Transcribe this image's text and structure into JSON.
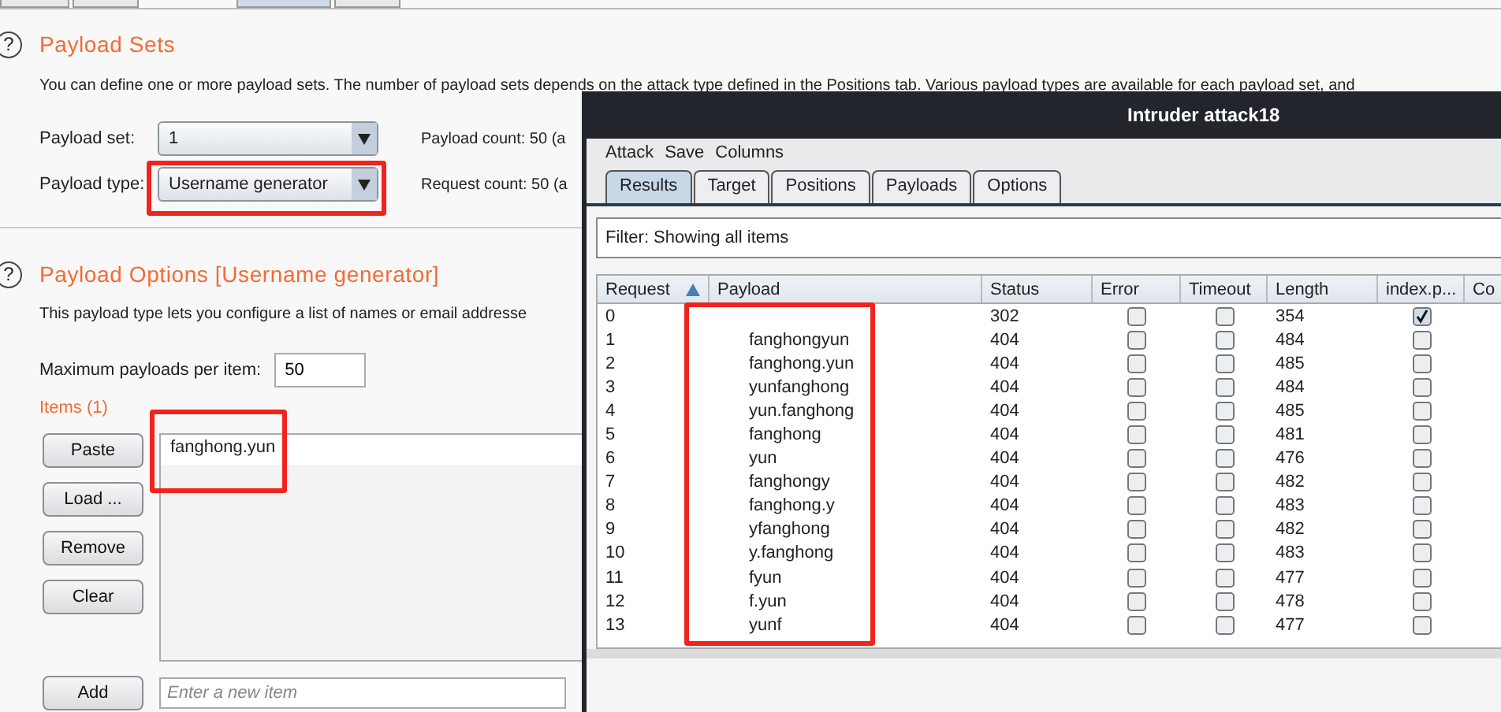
{
  "top_tabs": [
    {
      "selected": false
    },
    {
      "selected": false
    },
    {
      "selected": true
    },
    {
      "selected": false
    }
  ],
  "payload_sets": {
    "help_icon": "?",
    "title": "Payload Sets",
    "description": "You can define one or more payload sets. The number of payload sets depends on the attack type defined in the Positions tab. Various payload types are available for each payload set, and",
    "set_label": "Payload set:",
    "set_value": "1",
    "type_label": "Payload type:",
    "type_value": "Username generator",
    "payload_count": "Payload count:  50 (a",
    "request_count": "Request count:  50 (a"
  },
  "payload_options": {
    "help_icon": "?",
    "title": "Payload Options [Username generator]",
    "description": "This payload type lets you configure a list of names or email addresse",
    "max_label": "Maximum payloads per item:",
    "max_value": "50",
    "items_label": "Items (1)",
    "buttons": [
      "Paste",
      "Load ...",
      "Remove",
      "Clear"
    ],
    "items": [
      {
        "text": "fanghong.yun",
        "selected": true
      }
    ],
    "add_button": "Add",
    "add_placeholder": "Enter a new item"
  },
  "attack_window": {
    "title": "Intruder attack18",
    "menu": [
      "Attack",
      "Save",
      "Columns"
    ],
    "tabs": [
      {
        "label": "Results",
        "selected": true
      },
      {
        "label": "Target",
        "selected": false
      },
      {
        "label": "Positions",
        "selected": false
      },
      {
        "label": "Payloads",
        "selected": false
      },
      {
        "label": "Options",
        "selected": false
      }
    ],
    "filter": "Filter:  Showing all items",
    "table": {
      "columns": [
        "Request",
        "Payload",
        "Status",
        "Error",
        "Timeout",
        "Length",
        "index.p...",
        "Co"
      ],
      "rows": [
        {
          "request": "0",
          "payload": "",
          "status": "302",
          "error": false,
          "timeout": false,
          "length": "354",
          "column_7": true
        },
        {
          "request": "1",
          "payload": "fanghongyun",
          "status": "404",
          "error": false,
          "timeout": false,
          "length": "484",
          "column_7": false
        },
        {
          "request": "2",
          "payload": "fanghong.yun",
          "status": "404",
          "error": false,
          "timeout": false,
          "length": "485",
          "column_7": false
        },
        {
          "request": "3",
          "payload": "yunfanghong",
          "status": "404",
          "error": false,
          "timeout": false,
          "length": "484",
          "column_7": false
        },
        {
          "request": "4",
          "payload": "yun.fanghong",
          "status": "404",
          "error": false,
          "timeout": false,
          "length": "485",
          "column_7": false
        },
        {
          "request": "5",
          "payload": "fanghong",
          "status": "404",
          "error": false,
          "timeout": false,
          "length": "481",
          "column_7": false
        },
        {
          "request": "6",
          "payload": "yun",
          "status": "404",
          "error": false,
          "timeout": false,
          "length": "476",
          "column_7": false
        },
        {
          "request": "7",
          "payload": "fanghongy",
          "status": "404",
          "error": false,
          "timeout": false,
          "length": "482",
          "column_7": false
        },
        {
          "request": "8",
          "payload": "fanghong.y",
          "status": "404",
          "error": false,
          "timeout": false,
          "length": "483",
          "column_7": false
        },
        {
          "request": "9",
          "payload": "yfanghong",
          "status": "404",
          "error": false,
          "timeout": false,
          "length": "482",
          "column_7": false
        },
        {
          "request": "10",
          "payload": "y.fanghong",
          "status": "404",
          "error": false,
          "timeout": false,
          "length": "483",
          "column_7": false
        },
        {
          "request": "11",
          "payload": "fyun",
          "status": "404",
          "error": false,
          "timeout": false,
          "length": "477",
          "column_7": false
        },
        {
          "request": "12",
          "payload": "f.yun",
          "status": "404",
          "error": false,
          "timeout": false,
          "length": "478",
          "column_7": false
        },
        {
          "request": "13",
          "payload": "yunf",
          "status": "404",
          "error": false,
          "timeout": false,
          "length": "477",
          "column_7": false
        }
      ]
    }
  }
}
